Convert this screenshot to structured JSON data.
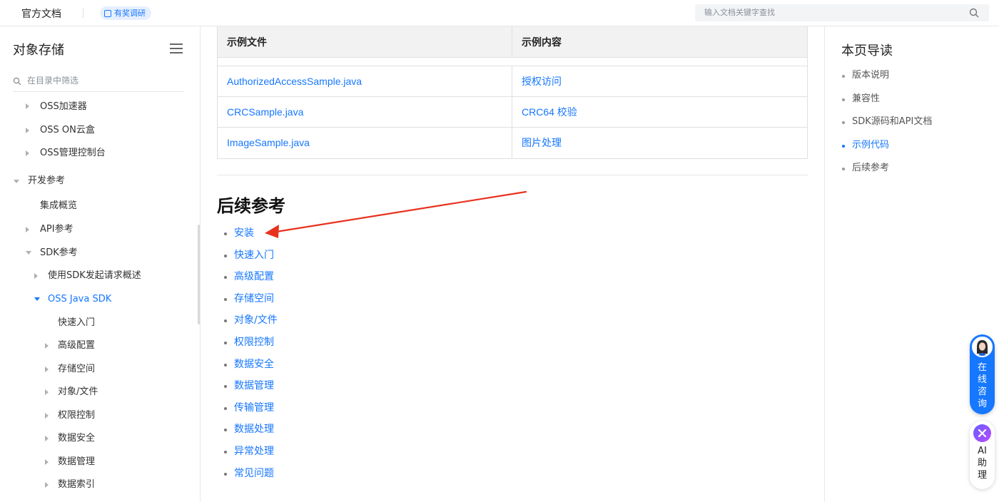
{
  "header": {
    "brand": "官方文档",
    "survey_label": "有奖调研",
    "search_placeholder": "输入文档关键字查找"
  },
  "sidebar": {
    "title": "对象存储",
    "filter_placeholder": "在目录中筛选",
    "items": [
      {
        "label": "OSS加速器"
      },
      {
        "label": "OSS ON云盒"
      },
      {
        "label": "OSS管理控制台"
      },
      {
        "label": "开发参考"
      },
      {
        "label": "集成概览"
      },
      {
        "label": "API参考"
      },
      {
        "label": "SDK参考"
      },
      {
        "label": "使用SDK发起请求概述"
      },
      {
        "label": "OSS Java SDK"
      },
      {
        "label": "快速入门"
      },
      {
        "label": "高级配置"
      },
      {
        "label": "存储空间"
      },
      {
        "label": "对象/文件"
      },
      {
        "label": "权限控制"
      },
      {
        "label": "数据安全"
      },
      {
        "label": "数据管理"
      },
      {
        "label": "数据索引"
      }
    ]
  },
  "main": {
    "table": {
      "headers": [
        "示例文件",
        "示例内容"
      ],
      "rows": [
        [
          "AuthorizedAccessSample.java",
          "授权访问"
        ],
        [
          "CRCSample.java",
          "CRC64 校验"
        ],
        [
          "ImageSample.java",
          "图片处理"
        ]
      ]
    },
    "section_title": "后续参考",
    "links": [
      "安装",
      "快速入门",
      "高级配置",
      "存储空间",
      "对象/文件",
      "权限控制",
      "数据安全",
      "数据管理",
      "传输管理",
      "数据处理",
      "异常处理",
      "常见问题"
    ]
  },
  "toc": {
    "title": "本页导读",
    "items": [
      "版本说明",
      "兼容性",
      "SDK源码和API文档",
      "示例代码",
      "后续参考"
    ],
    "active_index": 3
  },
  "widgets": {
    "consult_label": "在线咨询",
    "ai_label": "AI助理"
  },
  "colors": {
    "link": "#1677ff",
    "annotation_arrow": "#e8321e"
  }
}
